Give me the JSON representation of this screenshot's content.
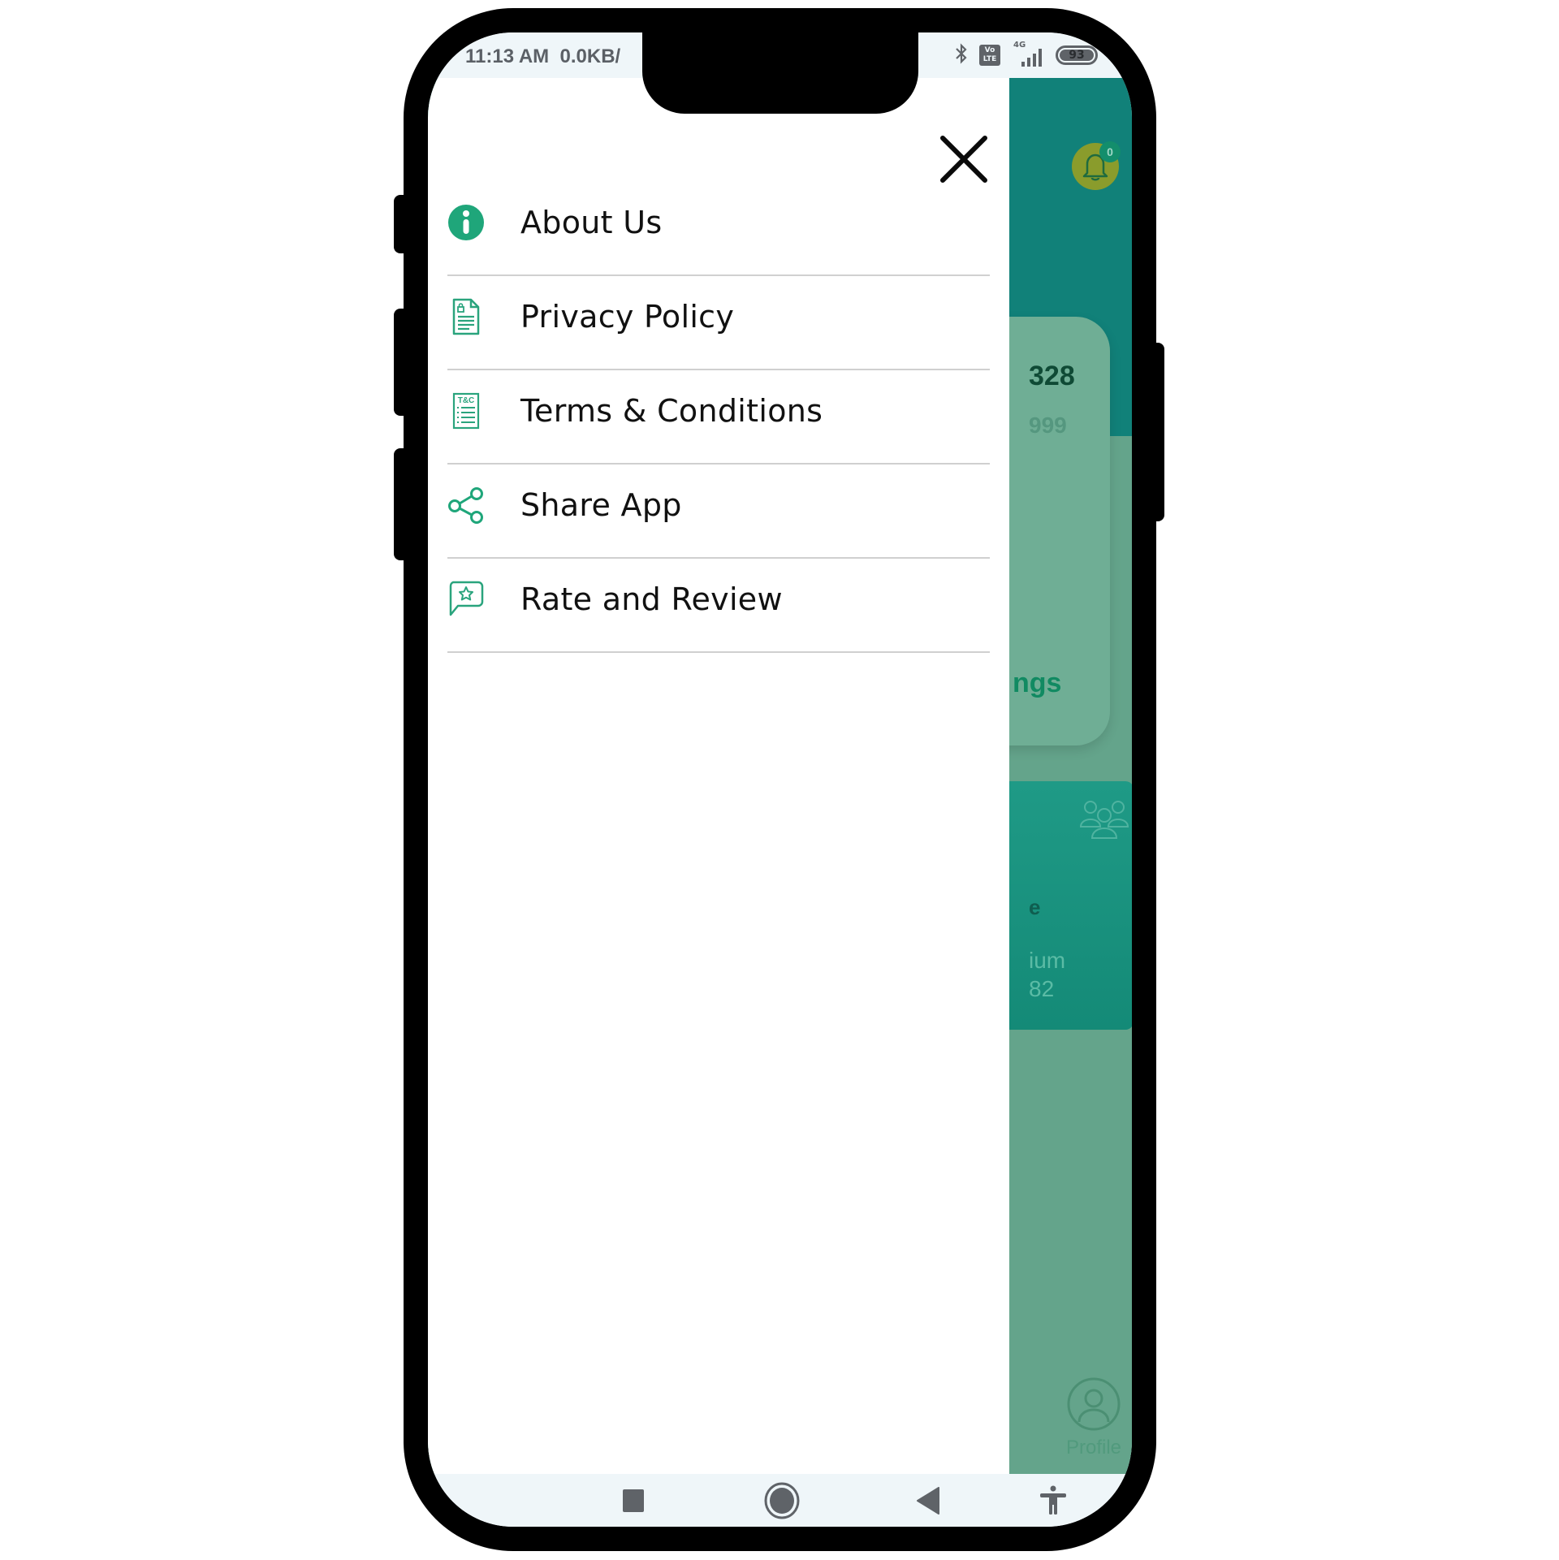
{
  "status_bar": {
    "time": "11:13 AM",
    "network_speed": "0.0KB/",
    "icons": [
      "bluetooth-icon",
      "volte-icon",
      "4g-signal-icon",
      "battery-icon"
    ],
    "volte_label_top": "Vo",
    "volte_label_bottom": "LTE",
    "network_type": "4G",
    "battery_level": "93"
  },
  "drawer": {
    "close_icon": "close-icon",
    "menu_items": [
      {
        "label": "About Us",
        "icon": "info-icon"
      },
      {
        "label": "Privacy Policy",
        "icon": "document-lock-icon"
      },
      {
        "label": "Terms & Conditions",
        "icon": "terms-document-icon",
        "icon_text": "T&C"
      },
      {
        "label": "Share App",
        "icon": "share-icon"
      },
      {
        "label": "Rate and Review",
        "icon": "review-star-icon"
      }
    ]
  },
  "background_app": {
    "notification_count": "0",
    "card1": {
      "number_partial": "328",
      "sub_partial": "999",
      "link_partial": "ngs"
    },
    "card2": {
      "title_partial": "e",
      "line1_partial": "ium",
      "line2_partial": "82"
    },
    "tab_profile_label": "Profile"
  },
  "nav_bar": {
    "buttons": [
      "recents-button",
      "home-button",
      "back-button",
      "accessibility-button"
    ]
  },
  "colors": {
    "accent": "#1fa67a",
    "header_teal": "#118179",
    "overlay_green": "#64a48b",
    "status_bar_bg": "#eff6f9",
    "divider": "#d0d0d0",
    "text_primary": "#111111"
  }
}
